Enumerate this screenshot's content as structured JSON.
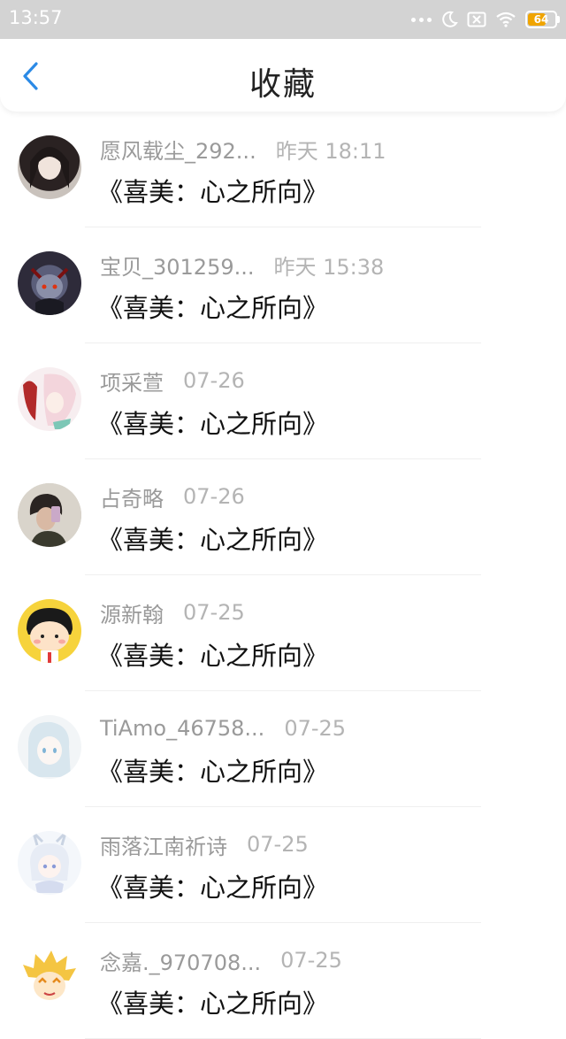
{
  "status_bar": {
    "time": "13:57",
    "battery": "64",
    "icons": [
      "more-dots-icon",
      "moon-icon",
      "no-sim-icon",
      "wifi-icon",
      "battery-icon"
    ]
  },
  "header": {
    "title": "收藏",
    "back_icon": "chevron-left-icon",
    "accent_color": "#2b8ae6"
  },
  "items": [
    {
      "name": "愿风载尘_292...",
      "date": "昨天 18:11",
      "work": "《喜美：心之所向》"
    },
    {
      "name": "宝贝_301259...",
      "date": "昨天 15:38",
      "work": "《喜美：心之所向》"
    },
    {
      "name": "项采萱",
      "date": "07-26",
      "work": "《喜美：心之所向》"
    },
    {
      "name": "占奇略",
      "date": "07-26",
      "work": "《喜美：心之所向》"
    },
    {
      "name": "源新翰",
      "date": "07-25",
      "work": "《喜美：心之所向》"
    },
    {
      "name": "TiAmo_46758...",
      "date": "07-25",
      "work": "《喜美：心之所向》"
    },
    {
      "name": "雨落江南祈诗",
      "date": "07-25",
      "work": "《喜美：心之所向》"
    },
    {
      "name": "念嘉._970708...",
      "date": "07-25",
      "work": "《喜美：心之所向》"
    }
  ]
}
